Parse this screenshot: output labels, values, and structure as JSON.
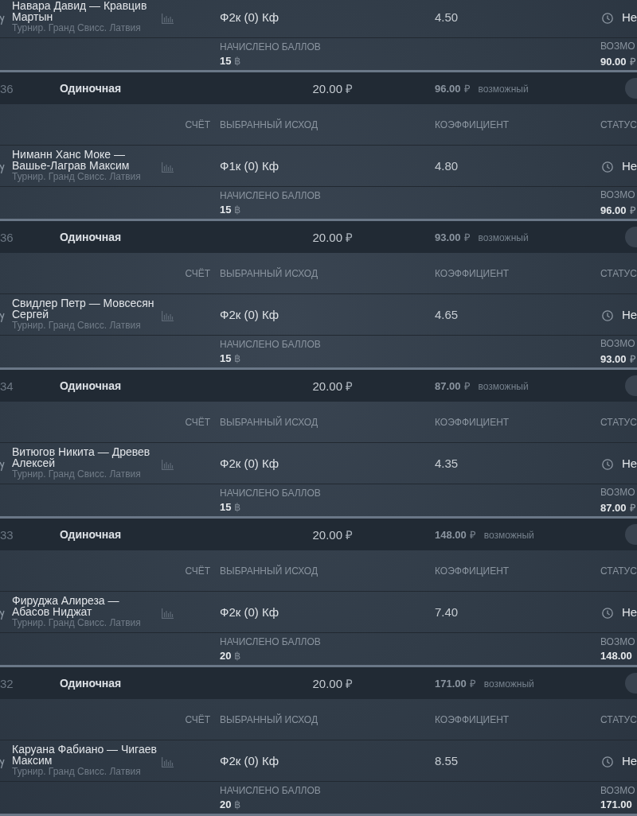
{
  "bets": [
    {
      "event": {
        "match": "Навара Давид — Кравцив Мартын",
        "tournament": "Турнир. Гранд Свисс. Латвия",
        "outcome": "Ф2к (0) Кф",
        "coefficient": "4.50",
        "status": "Не"
      },
      "points_label": "НАЧИСЛЕНО БАЛЛОВ",
      "points": "15",
      "points_symbol": "฿",
      "win_label": "ВОЗМО",
      "win": "90.00",
      "win_currency": "₽"
    },
    {
      "number": "36",
      "type": "Одиночная",
      "stake": "20.00",
      "stake_currency": "₽",
      "possible": "96.00",
      "possible_currency": "₽",
      "possible_label": "возможный",
      "column_headers": [
        "СЧЁТ",
        "ВЫБРАННЫЙ ИСХОД",
        "КОЭФФИЦИЕНТ",
        "СТАТУС"
      ],
      "event": {
        "match": "Ниманн Ханс Моке — Вашье-Лаграв Максим",
        "tournament": "Турнир. Гранд Свисс. Латвия",
        "outcome": "Ф1к (0) Кф",
        "coefficient": "4.80",
        "status": "Не"
      },
      "points_label": "НАЧИСЛЕНО БАЛЛОВ",
      "points": "15",
      "points_symbol": "฿",
      "win_label": "ВОЗМО",
      "win": "96.00",
      "win_currency": "₽"
    },
    {
      "number": "36",
      "type": "Одиночная",
      "stake": "20.00",
      "stake_currency": "₽",
      "possible": "93.00",
      "possible_currency": "₽",
      "possible_label": "возможный",
      "column_headers": [
        "СЧЁТ",
        "ВЫБРАННЫЙ ИСХОД",
        "КОЭФФИЦИЕНТ",
        "СТАТУС"
      ],
      "event": {
        "match": "Свидлер Петр — Мовсесян Сергей",
        "tournament": "Турнир. Гранд Свисс. Латвия",
        "outcome": "Ф2к (0) Кф",
        "coefficient": "4.65",
        "status": "Не"
      },
      "points_label": "НАЧИСЛЕНО БАЛЛОВ",
      "points": "15",
      "points_symbol": "฿",
      "win_label": "ВОЗМО",
      "win": "93.00",
      "win_currency": "₽"
    },
    {
      "number": "34",
      "type": "Одиночная",
      "stake": "20.00",
      "stake_currency": "₽",
      "possible": "87.00",
      "possible_currency": "₽",
      "possible_label": "возможный",
      "column_headers": [
        "СЧЁТ",
        "ВЫБРАННЫЙ ИСХОД",
        "КОЭФФИЦИЕНТ",
        "СТАТУС"
      ],
      "event": {
        "match": "Витюгов Никита — Древев Алексей",
        "tournament": "Турнир. Гранд Свисс. Латвия",
        "outcome": "Ф2к (0) Кф",
        "coefficient": "4.35",
        "status": "Не"
      },
      "points_label": "НАЧИСЛЕНО БАЛЛОВ",
      "points": "15",
      "points_symbol": "฿",
      "win_label": "ВОЗМО",
      "win": "87.00",
      "win_currency": "₽"
    },
    {
      "number": "33",
      "type": "Одиночная",
      "stake": "20.00",
      "stake_currency": "₽",
      "possible": "148.00",
      "possible_currency": "₽",
      "possible_label": "возможный",
      "column_headers": [
        "СЧЁТ",
        "ВЫБРАННЫЙ ИСХОД",
        "КОЭФФИЦИЕНТ",
        "СТАТУС"
      ],
      "event": {
        "match": "Фируджа Алиреза — Абасов Ниджат",
        "tournament": "Турнир. Гранд Свисс. Латвия",
        "outcome": "Ф2к (0) Кф",
        "coefficient": "7.40",
        "status": "Не"
      },
      "points_label": "НАЧИСЛЕНО БАЛЛОВ",
      "points": "20",
      "points_symbol": "฿",
      "win_label": "ВОЗМО",
      "win": "148.00"
    },
    {
      "number": "32",
      "type": "Одиночная",
      "stake": "20.00",
      "stake_currency": "₽",
      "possible": "171.00",
      "possible_currency": "₽",
      "possible_label": "возможный",
      "column_headers": [
        "СЧЁТ",
        "ВЫБРАННЫЙ ИСХОД",
        "КОЭФФИЦИЕНТ",
        "СТАТУС"
      ],
      "event": {
        "match": "Каруана Фабиано — Чигаев Максим",
        "tournament": "Турнир. Гранд Свисс. Латвия",
        "outcome": "Ф2к (0) Кф",
        "coefficient": "8.55",
        "status": "Не"
      },
      "points_label": "НАЧИСЛЕНО БАЛЛОВ",
      "points": "20",
      "points_symbol": "฿",
      "win_label": "ВОЗМО",
      "win": "171.00"
    }
  ]
}
